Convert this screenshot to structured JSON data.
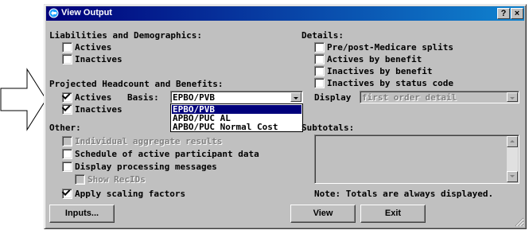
{
  "window": {
    "title": "View Output",
    "help_label": "?",
    "close_label": "×"
  },
  "liabilities": {
    "heading": "Liabilities and Demographics:",
    "actives": {
      "label": "Actives",
      "checked": false
    },
    "inactives": {
      "label": "Inactives",
      "checked": false
    }
  },
  "projected": {
    "heading": "Projected Headcount and Benefits:",
    "actives": {
      "label": "Actives",
      "checked": true
    },
    "inactives": {
      "label": "Inactives",
      "checked": true
    },
    "basis_label": "Basis:",
    "basis_value": "EPBO/PVB",
    "basis_options": [
      "EPBO/PVB",
      "APBO/PUC AL",
      "APBO/PUC Normal Cost"
    ],
    "basis_selected_index": 0
  },
  "details": {
    "heading": "Details:",
    "items": [
      {
        "label": "Pre/post-Medicare splits",
        "checked": false
      },
      {
        "label": "Actives by benefit",
        "checked": false
      },
      {
        "label": "Inactives by benefit",
        "checked": false
      },
      {
        "label": "Inactives by status code",
        "checked": false
      }
    ],
    "display_label": "Display",
    "display_value": "first order detail"
  },
  "other": {
    "heading": "Other:",
    "individual": {
      "label": "Individual aggregate results",
      "checked": false,
      "disabled": true
    },
    "schedule": {
      "label": "Schedule of active participant data",
      "checked": false
    },
    "processing": {
      "label": "Display processing messages",
      "checked": false
    },
    "show_recids": {
      "label": "Show RecIDs",
      "checked": false,
      "disabled": true
    },
    "scaling": {
      "label": "Apply scaling factors",
      "checked": true
    }
  },
  "subtotals": {
    "heading": "Subtotals:"
  },
  "note": "Note:  Totals are always displayed.",
  "buttons": {
    "inputs": "Inputs...",
    "view": "View",
    "exit": "Exit"
  },
  "colors": {
    "title_bar": "#00007b",
    "dialog_face": "#c0c0c0",
    "selection": "#00007b"
  }
}
